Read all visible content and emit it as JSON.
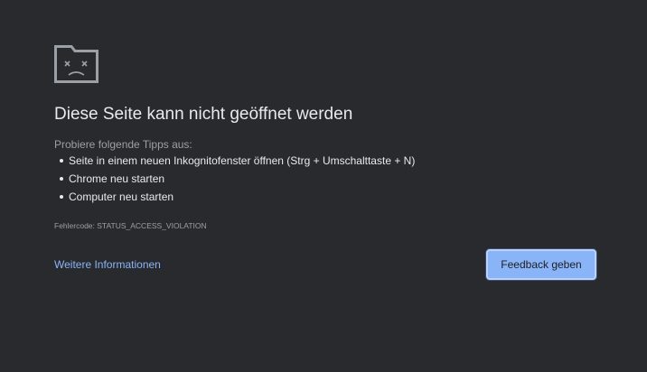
{
  "error_page": {
    "title": "Diese Seite kann nicht geöffnet werden",
    "tips_intro": "Probiere folgende Tipps aus:",
    "tips": [
      "Seite in einem neuen Inkognitofenster öffnen (Strg + Umschalttaste + N)",
      "Chrome neu starten",
      "Computer neu starten"
    ],
    "error_code": "Fehlercode: STATUS_ACCESS_VIOLATION",
    "more_info_link": "Weitere Informationen",
    "feedback_button": "Feedback geben"
  },
  "icons": {
    "header": "sad-tab-icon"
  },
  "colors": {
    "background": "#292a2d",
    "text_primary": "#e8eaed",
    "text_secondary": "#9aa0a6",
    "link": "#8ab4f8",
    "button_bg": "#8ab4f8",
    "button_text": "#202124"
  }
}
